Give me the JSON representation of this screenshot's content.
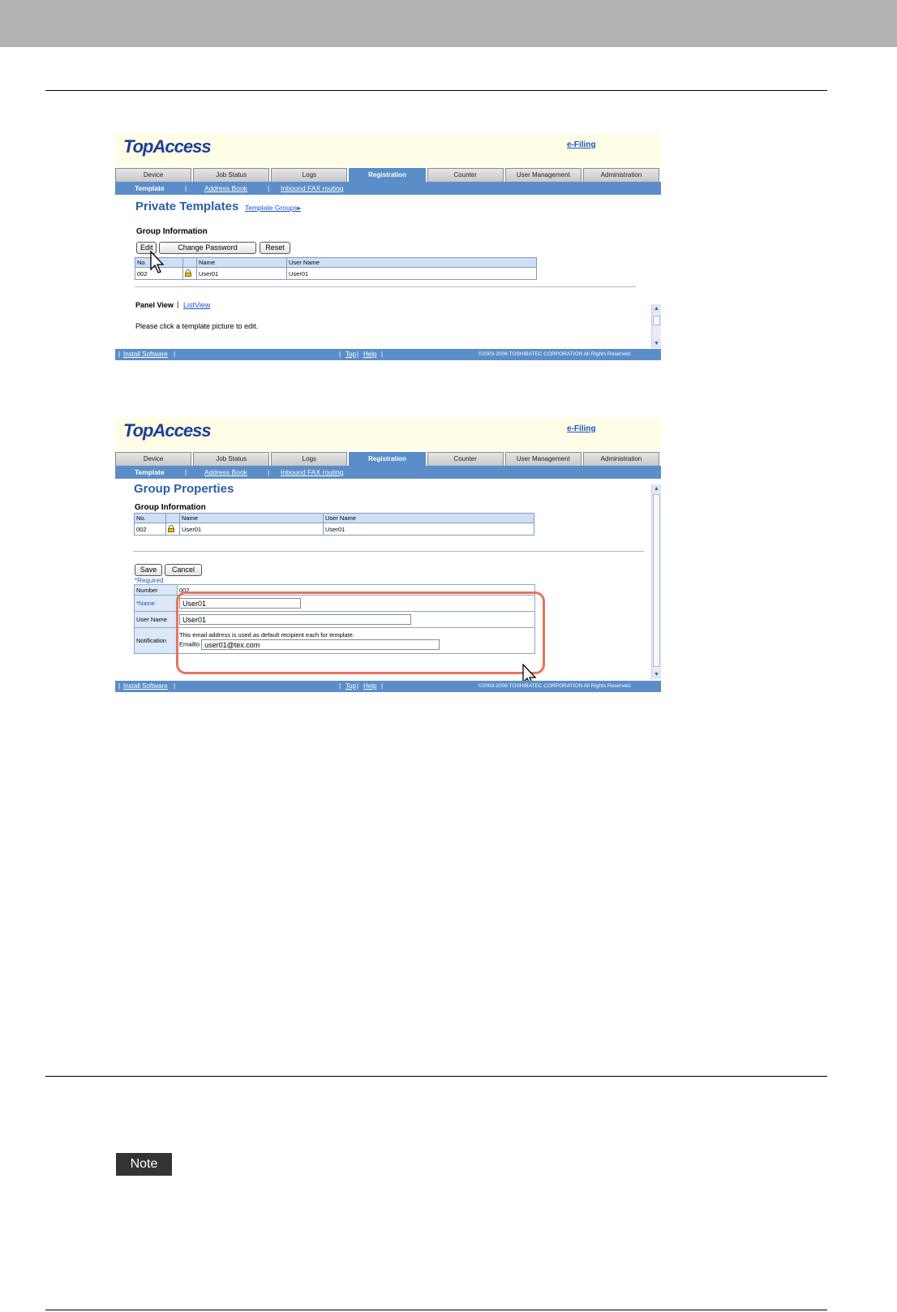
{
  "brand": "TopAccess",
  "efiling_link": "e-Filing",
  "tabs": [
    "Device",
    "Job Status",
    "Logs",
    "Registration",
    "Counter",
    "User Management",
    "Administration"
  ],
  "subnav": {
    "template": "Template",
    "address_book": "Address Book",
    "inbound_fax": "Inbound FAX routing",
    "sep": "|"
  },
  "footer": {
    "install": "Install Software",
    "top": "Top",
    "help": "Help",
    "copyright": "©2003-2006 TOSHIBATEC CORPORATION All Rights Reserved.",
    "bar": "|"
  },
  "shot1": {
    "title": "Private Templates",
    "template_groups_link": "Template Groups▸",
    "group_info": "Group Information",
    "buttons": {
      "edit": "Edit",
      "change_password": "Change Password",
      "reset": "Reset"
    },
    "table": {
      "headers": [
        "No.",
        "",
        "Name",
        "User Name"
      ],
      "row": [
        "002",
        "",
        "User01",
        "User01"
      ]
    },
    "panel_view": "Panel View",
    "list_view": "ListView",
    "sep": "|",
    "hint": "Please click a template picture to edit."
  },
  "shot2": {
    "title": "Group Properties",
    "group_info": "Group Information",
    "table": {
      "headers": [
        "No.",
        "",
        "Name",
        "User Name"
      ],
      "row": [
        "002",
        "",
        "User01",
        "User01"
      ]
    },
    "buttons": {
      "save": "Save",
      "cancel": "Cancel"
    },
    "required": "*Required",
    "form": {
      "number_label": "Number",
      "number_value": "002",
      "name_label": "*Name",
      "name_value": "User01",
      "username_label": "User Name",
      "username_value": "User01",
      "notification_label": "Notification",
      "notification_text": "This email address is used as default recipient each for template.",
      "emailto_label": "Emailto",
      "emailto_value": "user01@tex.com"
    }
  },
  "note_label": "Note",
  "colors": {
    "accent": "#5b8ec8",
    "title": "#2a5ea8",
    "highlight": "#e8735c",
    "band": "#b3b3b3"
  }
}
